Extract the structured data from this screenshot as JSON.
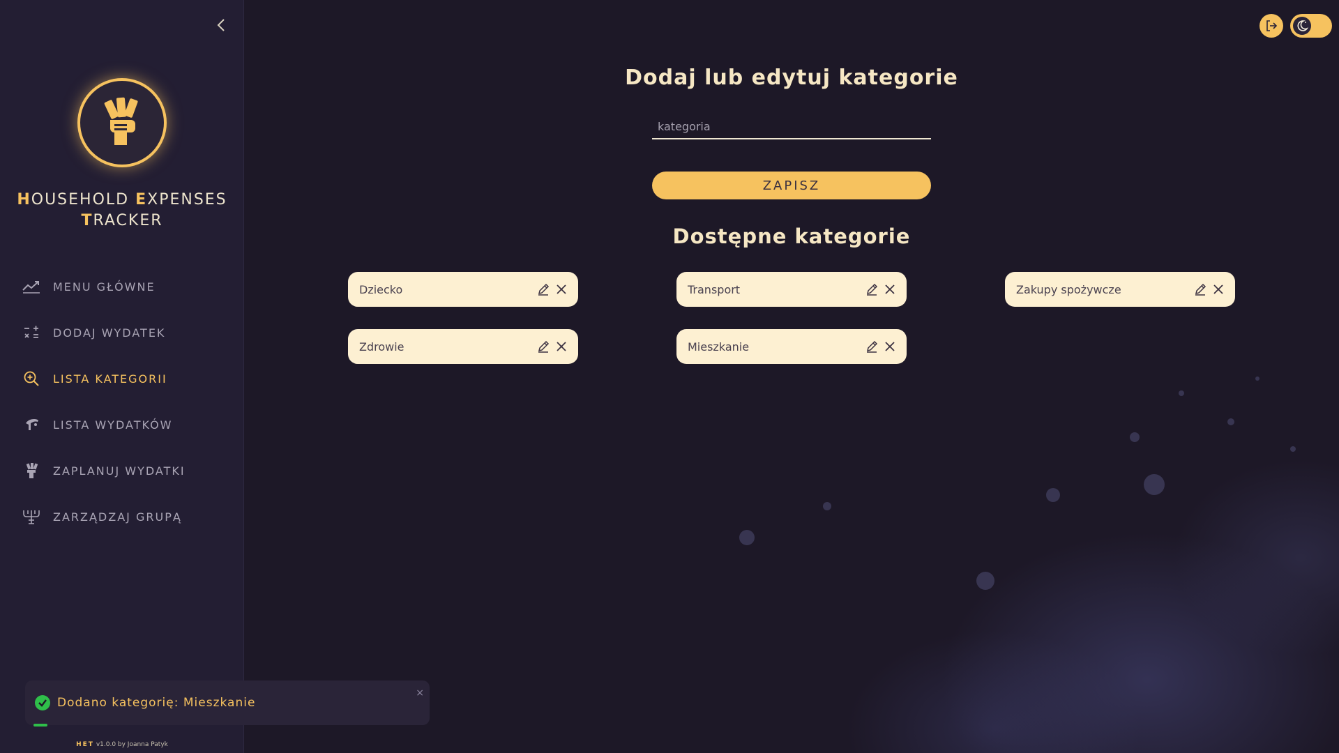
{
  "sidebar": {
    "brand": {
      "line1": [
        {
          "accent": "H",
          "rest": "OUSEHOLD "
        },
        {
          "accent": "E",
          "rest": "XPENSES"
        }
      ],
      "line2": [
        {
          "accent": "T",
          "rest": "RACKER"
        }
      ]
    },
    "nav": [
      {
        "label": "MENU GŁÓWNE",
        "icon": "trend-chart-icon",
        "active": false
      },
      {
        "label": "DODAJ WYDATEK",
        "icon": "calculator-signs-icon",
        "active": false
      },
      {
        "label": "LISTA KATEGORII",
        "icon": "search-plus-icon",
        "active": true
      },
      {
        "label": "LISTA WYDATKÓW",
        "icon": "hand-coins-icon",
        "active": false
      },
      {
        "label": "ZAPLANUJ WYDATKI",
        "icon": "money-bag-icon",
        "active": false
      },
      {
        "label": "ZARZĄDZAJ GRUPĄ",
        "icon": "group-tree-icon",
        "active": false
      }
    ],
    "footer": {
      "brand": "HET",
      "version": "v1.0.0 by Joanna Patyk"
    }
  },
  "main": {
    "title": "Dodaj lub edytuj kategorie",
    "input": {
      "placeholder": "kategoria",
      "value": ""
    },
    "save_label": "ZAPISZ",
    "categories_title": "Dostępne kategorie",
    "categories": [
      {
        "name": "Dziecko"
      },
      {
        "name": "Transport"
      },
      {
        "name": "Zakupy spożywcze"
      },
      {
        "name": "Zdrowie"
      },
      {
        "name": "Mieszkanie"
      }
    ]
  },
  "toast": {
    "message": "Dodano kategorię: Mieszkanie",
    "close": "×"
  },
  "colors": {
    "accent": "#f6c25f",
    "background": "#1d1827",
    "sidebar": "#231e33",
    "chip": "#fdf0d2",
    "success": "#2fbf4a"
  }
}
